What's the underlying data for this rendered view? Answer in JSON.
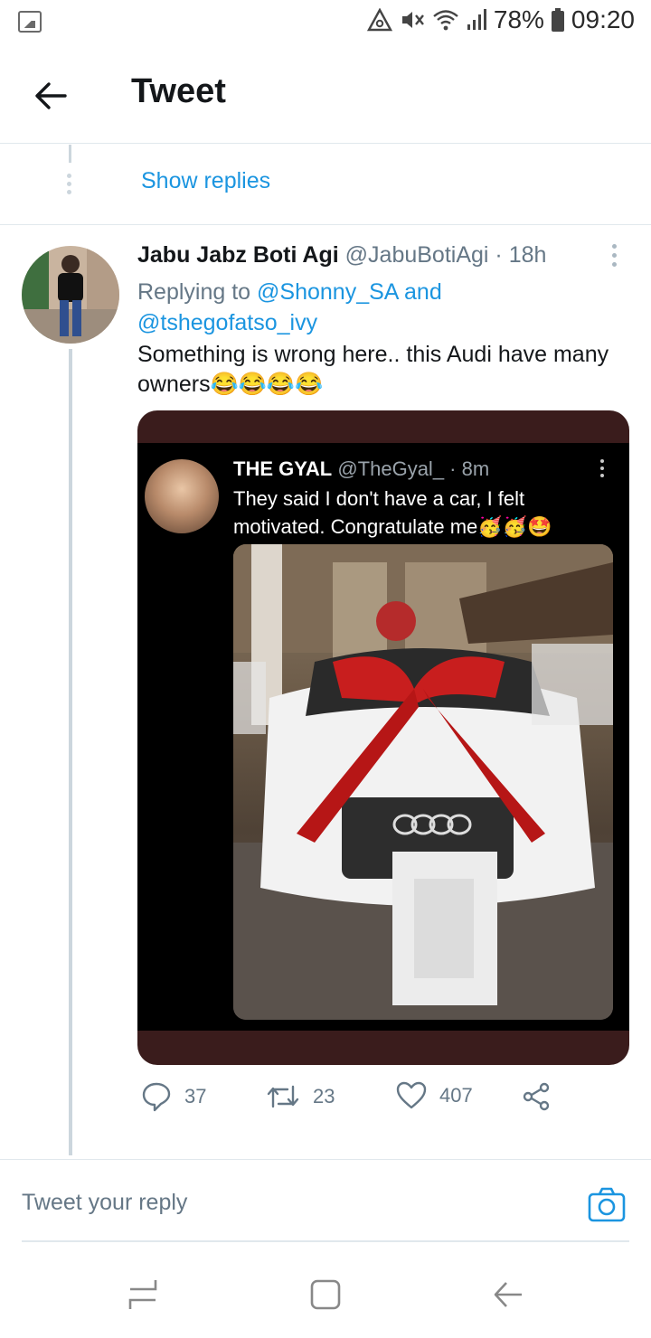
{
  "status_bar": {
    "battery_percent": "78%",
    "time": "09:20",
    "icons": [
      "gallery-icon",
      "data-saver-icon",
      "mute-icon",
      "wifi-icon",
      "signal-icon",
      "battery-icon"
    ]
  },
  "header": {
    "title": "Tweet",
    "back_icon": "arrow-left-icon"
  },
  "thread": {
    "show_replies": "Show replies"
  },
  "tweet": {
    "name": "Jabu Jabz Boti Agi",
    "handle": "@JabuBotiAgi",
    "time": " · 18h",
    "replying_prefix": "Replying to ",
    "reply_user_1": "@Shonny_SA",
    "reply_and": " and",
    "reply_user_2": "@tshegofatso_ivy",
    "text": "Something is wrong here.. this Audi have many owners😂😂😂😂",
    "embedded": {
      "name": "THE GYAL",
      "handle": "@TheGyal_",
      "time": " · 8m",
      "text": "They said I don't have a car, I felt motivated. Congratulate me🥳🥳🤩"
    },
    "actions": {
      "replies": "37",
      "retweets": "23",
      "likes": "407"
    }
  },
  "composer": {
    "placeholder": "Tweet your reply"
  },
  "colors": {
    "accent": "#1b95e0",
    "secondary_text": "#657786",
    "divider": "#e1e8ed"
  }
}
